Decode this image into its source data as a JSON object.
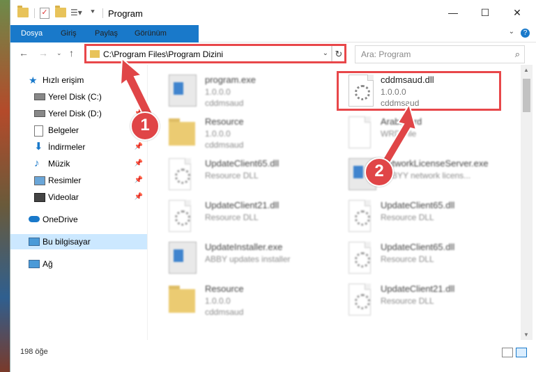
{
  "window": {
    "title": "Program"
  },
  "ribbon": {
    "tabs": [
      "Dosya",
      "Giriş",
      "Paylaş",
      "Görünüm"
    ]
  },
  "address": {
    "path": "C:\\Program Files\\Program Dizini"
  },
  "search": {
    "placeholder": "Ara: Program"
  },
  "sidebar": {
    "items": [
      {
        "label": "Hızlı erişim",
        "icon": "star-icon"
      },
      {
        "label": "Yerel Disk (C:)",
        "icon": "drive-icon"
      },
      {
        "label": "Yerel Disk (D:)",
        "icon": "drive-icon"
      },
      {
        "label": "Belgeler",
        "icon": "documents-icon"
      },
      {
        "label": "İndirmeler",
        "icon": "download-icon"
      },
      {
        "label": "Müzik",
        "icon": "music-icon"
      },
      {
        "label": "Resimler",
        "icon": "pictures-icon"
      },
      {
        "label": "Videolar",
        "icon": "videos-icon"
      },
      {
        "label": "OneDrive",
        "icon": "cloud-icon"
      },
      {
        "label": "Bu bilgisayar",
        "icon": "computer-icon"
      },
      {
        "label": "Ağ",
        "icon": "network-icon"
      }
    ]
  },
  "files": [
    {
      "name": "program.exe",
      "sub1": "1.0.0.0",
      "sub2": "cddmsaud",
      "type": "exe"
    },
    {
      "name": "cddmsaud.dll",
      "sub1": "1.0.0.0",
      "sub2": "cddmsaud",
      "type": "dll"
    },
    {
      "name": "Resource",
      "sub1": "1.0.0.0",
      "sub2": "cddmsaud",
      "type": "folder"
    },
    {
      "name": "Arabic.grd",
      "sub1": "WRD File",
      "sub2": "",
      "type": "doc"
    },
    {
      "name": "UpdateClient65.dll",
      "sub1": "Resource DLL",
      "sub2": "",
      "type": "dll"
    },
    {
      "name": "NetworkLicenseServer.exe",
      "sub1": "ABBYY network licens...",
      "sub2": "",
      "type": "exe"
    },
    {
      "name": "UpdateClient21.dll",
      "sub1": "Resource DLL",
      "sub2": "",
      "type": "dll"
    },
    {
      "name": "UpdateClient65.dll",
      "sub1": "Resource DLL",
      "sub2": "",
      "type": "dll"
    },
    {
      "name": "UpdateInstaller.exe",
      "sub1": "ABBY updates installer",
      "sub2": "",
      "type": "exe"
    },
    {
      "name": "UpdateClient65.dll",
      "sub1": "Resource DLL",
      "sub2": "",
      "type": "dll"
    },
    {
      "name": "Resource",
      "sub1": "1.0.0.0",
      "sub2": "cddmsaud",
      "type": "folder"
    },
    {
      "name": "UpdateClient21.dll",
      "sub1": "Resource DLL",
      "sub2": "",
      "type": "dll"
    }
  ],
  "status": {
    "count": "198 öğe"
  },
  "annotations": {
    "step1": "1",
    "step2": "2",
    "color": "#e04547"
  }
}
